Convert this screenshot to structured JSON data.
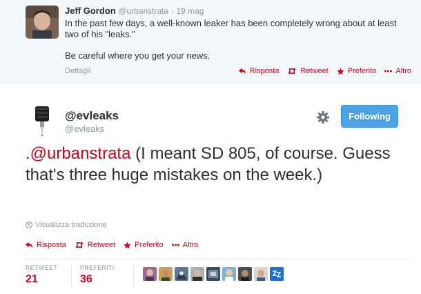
{
  "reply_tweet": {
    "author_name": "Jeff Gordon",
    "author_handle": "@urbanstrata",
    "separator": "·",
    "time": "19 mag",
    "text_line1": "In the past few days, a well-known leaker has been completely wrong about at least two of his \"leaks.\"",
    "text_line2": "Be careful where you get your news.",
    "details_label": "Dettagli",
    "actions": {
      "reply": "Risposta",
      "retweet": "Retweet",
      "favorite": "Preferito",
      "more": "Altro"
    }
  },
  "main_tweet": {
    "author_name": "@evleaks",
    "author_handle": "@evleaks",
    "follow_label": "Following",
    "text_prefix": ".",
    "mention": "@urbanstrata",
    "text_body": " (I meant SD 805, of course. Guess that's three huge mistakes on the week.)",
    "translate_label": "Visualizza traduzione",
    "actions": {
      "reply": "Risposta",
      "retweet": "Retweet",
      "favorite": "Preferito",
      "more": "Altro"
    },
    "stats": {
      "retweets_label": "RETWEET",
      "retweets_value": "21",
      "favorites_label": "PREFERITI",
      "favorites_value": "36"
    },
    "favorited_by_count_shown": 9
  },
  "colors": {
    "accent_red": "#d0021b",
    "follow_blue": "#4ba3e3",
    "muted_gray": "#8899a6",
    "text_dark": "#292f33",
    "reply_bg": "#f5f8fa"
  },
  "icons": [
    "reply-arrow-icon",
    "retweet-icon",
    "star-icon",
    "more-dots-icon",
    "gear-icon",
    "globe-icon"
  ]
}
